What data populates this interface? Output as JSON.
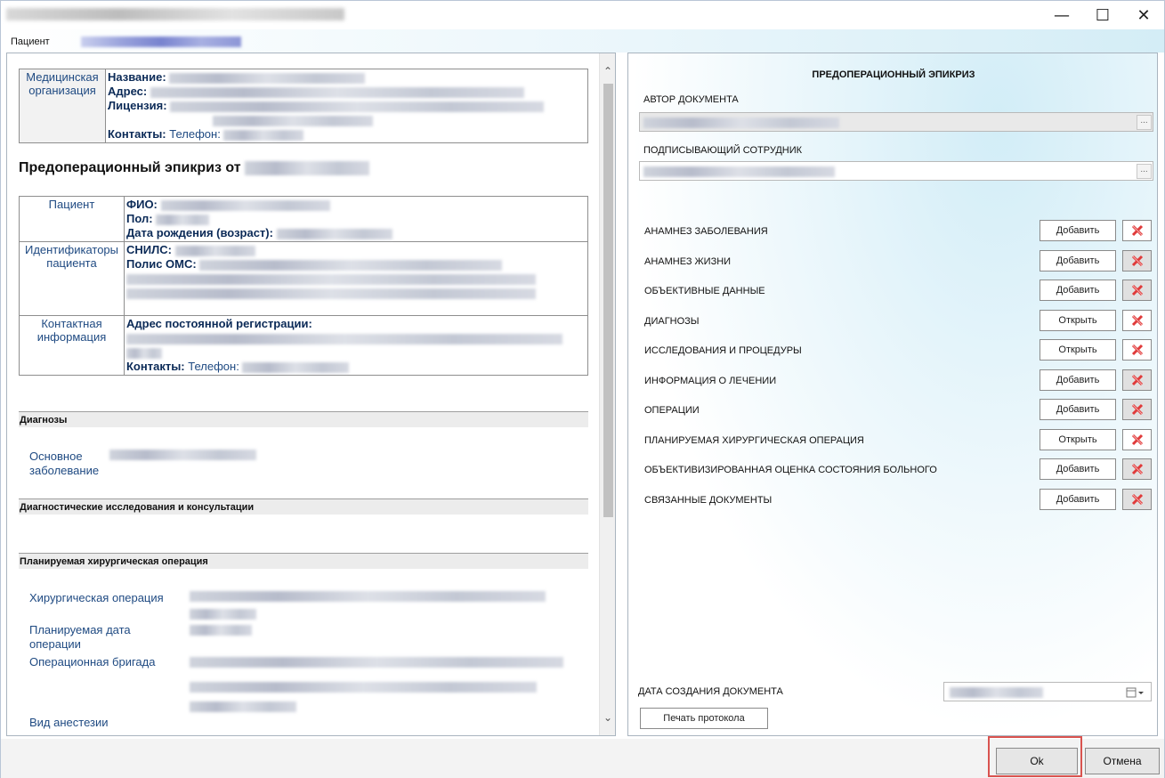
{
  "window": {
    "minimize_glyph": "—",
    "maximize_glyph": "☐",
    "close_glyph": "✕"
  },
  "patient_bar": {
    "label": "Пациент"
  },
  "left": {
    "org": {
      "label": "Медицинская организация",
      "name_key": "Название:",
      "address_key": "Адрес:",
      "license_key": "Лицензия:",
      "contacts_key": "Контакты:",
      "phone_key": "Телефон:"
    },
    "heading": "Предоперационный эпикриз от",
    "patient": {
      "label": "Пациент",
      "fio_key": "ФИО:",
      "sex_key": "Пол:",
      "dob_key": "Дата рождения (возраст):"
    },
    "identifiers": {
      "label": "Идентификаторы пациента",
      "snils_key": "СНИЛС:",
      "oms_key": "Полис ОМС:"
    },
    "contact": {
      "label": "Контактная информация",
      "address_key": "Адрес постоянной регистрации:",
      "contacts_key": "Контакты:",
      "phone_key": "Телефон:"
    },
    "sections": {
      "diagnoses": "Диагнозы",
      "main_disease": "Основное заболевание",
      "diag_studies": "Диагностические исследования и консультации",
      "planned_op": "Планируемая хирургическая операция",
      "surgery": "Хирургическая операция",
      "planned_date": "Планируемая дата операции",
      "op_team": "Операционная бригада",
      "anesthesia": "Вид анестезии"
    }
  },
  "right": {
    "title": "ПРЕДОПЕРАЦИОННЫЙ ЭПИКРИЗ",
    "author_label": "АВТОР ДОКУМЕНТА",
    "signer_label": "ПОДПИСЫВАЮЩИЙ СОТРУДНИК",
    "ellipsis": "...",
    "rows": [
      {
        "name": "АНАМНЕЗ ЗАБОЛЕВАНИЯ",
        "action": "Добавить",
        "del_grey": false
      },
      {
        "name": "АНАМНЕЗ ЖИЗНИ",
        "action": "Добавить",
        "del_grey": true
      },
      {
        "name": "ОБЪЕКТИВНЫЕ ДАННЫЕ",
        "action": "Добавить",
        "del_grey": true
      },
      {
        "name": "ДИАГНОЗЫ",
        "action": "Открыть",
        "del_grey": false
      },
      {
        "name": "ИССЛЕДОВАНИЯ И ПРОЦЕДУРЫ",
        "action": "Открыть",
        "del_grey": false
      },
      {
        "name": "ИНФОРМАЦИЯ О ЛЕЧЕНИИ",
        "action": "Добавить",
        "del_grey": true
      },
      {
        "name": "ОПЕРАЦИИ",
        "action": "Добавить",
        "del_grey": true
      },
      {
        "name": "ПЛАНИРУЕМАЯ ХИРУРГИЧЕСКАЯ ОПЕРАЦИЯ",
        "action": "Открыть",
        "del_grey": false
      },
      {
        "name": "ОБЪЕКТИВИЗИРОВАННАЯ ОЦЕНКА СОСТОЯНИЯ БОЛЬНОГО",
        "action": "Добавить",
        "del_grey": true
      },
      {
        "name": "СВЯЗАННЫЕ ДОКУМЕНТЫ",
        "action": "Добавить",
        "del_grey": true
      }
    ],
    "date_label": "ДАТА СОЗДАНИЯ ДОКУМЕНТА",
    "print_label": "Печать протокола"
  },
  "footer": {
    "ok": "Ok",
    "cancel": "Отмена"
  }
}
